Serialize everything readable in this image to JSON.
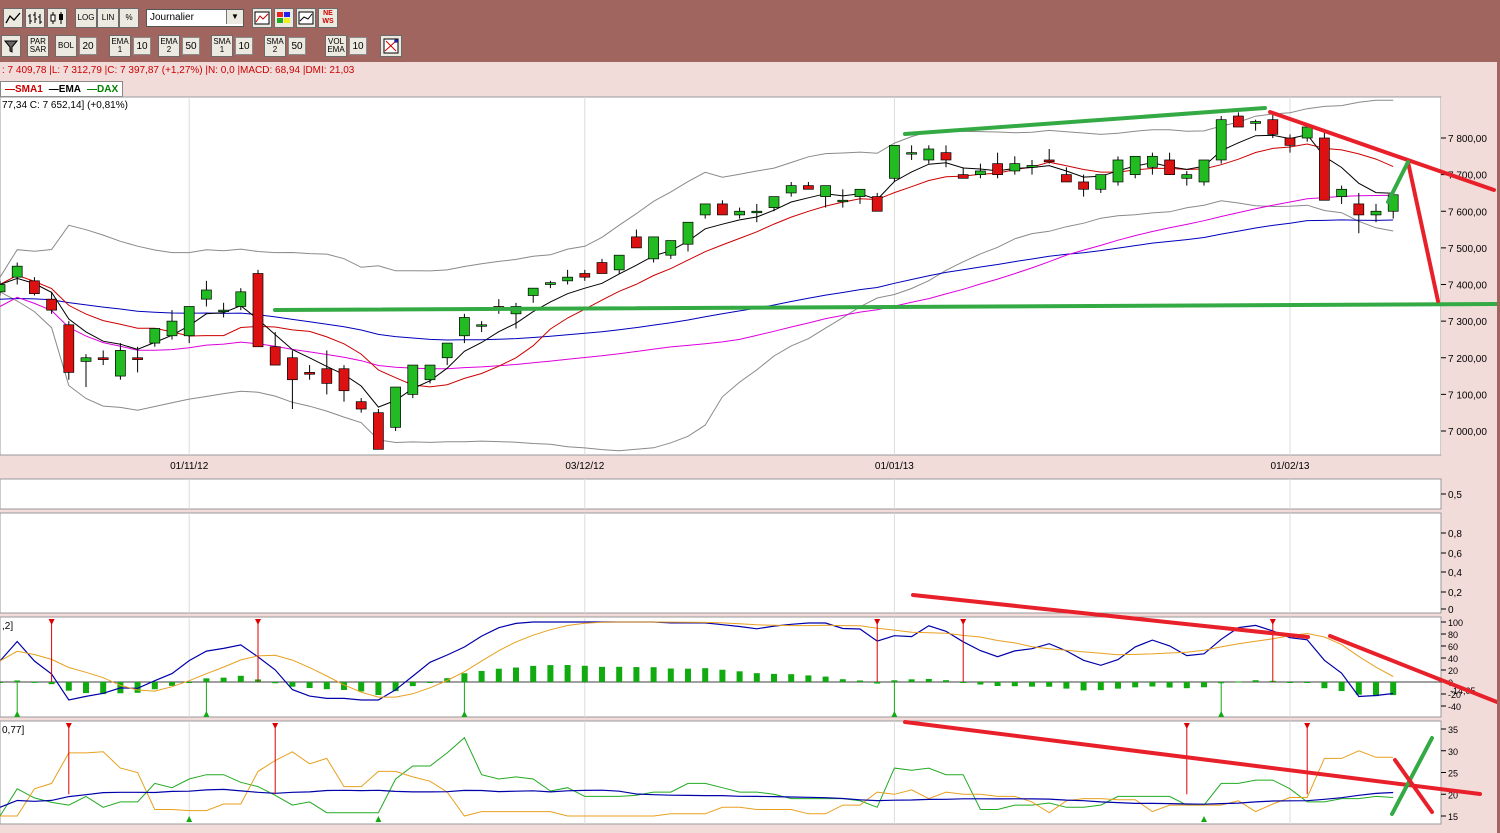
{
  "toolbar1": {
    "chart_style_buttons": [
      "line-chart-icon",
      "bar-chart-icon",
      "candlestick-icon"
    ],
    "scale_buttons": [
      "LOG",
      "LIN",
      "%"
    ],
    "period_value": "Journalier",
    "tool_buttons": [
      "zoom-icon",
      "color-icon",
      "compare-icon",
      "news-icon"
    ],
    "news_label": "NE\nWS"
  },
  "toolbar2": {
    "items": [
      {
        "label": "PAR\nSAR",
        "value": ""
      },
      {
        "label": "BOL",
        "value": "20"
      },
      {
        "label": "EMA\n1",
        "value": "10"
      },
      {
        "label": "EMA\n2",
        "value": "50"
      },
      {
        "label": "SMA\n1",
        "value": "10"
      },
      {
        "label": "SMA\n2",
        "value": "50"
      },
      {
        "label": "VOL\nEMA",
        "value": "10"
      }
    ]
  },
  "ohlc_line": ": 7 409,78 |L: 7 312,79 |C: 7 397,87 (+1,27%) |N: 0,0 |MACD: 68,94 |DMI: 21,03",
  "legend": [
    {
      "name": "SMA1",
      "color": "#cc0000"
    },
    {
      "name": "EMA",
      "color": "#000000"
    },
    {
      "name": "DAX",
      "color": "#008000"
    }
  ],
  "price_info": "77,34  C: 7 652,14] (+0,81%)",
  "macd_label": ",2]",
  "dmi_label": "0,77]",
  "colors": {
    "up_candle": "#22bb22",
    "down_candle": "#dd1111",
    "sma1": "#cc0000",
    "ema": "#000000",
    "blue_ma": "#0000bb",
    "magenta_ma": "#dd00dd",
    "bollinger": "#8a8a8a",
    "annotation_green": "#33aa44",
    "annotation_red": "#e8202a"
  },
  "chart_data": [
    {
      "type": "candlestick",
      "title": "DAX",
      "x_ticks": [
        "01/11/12",
        "03/12/12",
        "01/01/13",
        "01/02/13"
      ],
      "y_ticks": [
        "7 800,00",
        "7 700,00",
        "7 600,00",
        "7 500,00",
        "7 400,00",
        "7 300,00",
        "7 200,00",
        "7 100,00",
        "7 000,00"
      ],
      "ylim": [
        6950,
        7880
      ],
      "candles": [
        [
          7380,
          7410,
          7370,
          7400
        ],
        [
          7420,
          7460,
          7400,
          7450
        ],
        [
          7410,
          7420,
          7370,
          7375
        ],
        [
          7360,
          7380,
          7320,
          7330
        ],
        [
          7290,
          7300,
          7140,
          7160
        ],
        [
          7190,
          7210,
          7120,
          7200
        ],
        [
          7200,
          7220,
          7180,
          7195
        ],
        [
          7150,
          7240,
          7140,
          7220
        ],
        [
          7200,
          7230,
          7160,
          7195
        ],
        [
          7240,
          7280,
          7230,
          7280
        ],
        [
          7260,
          7330,
          7250,
          7300
        ],
        [
          7260,
          7330,
          7240,
          7340
        ],
        [
          7360,
          7410,
          7340,
          7385
        ],
        [
          7330,
          7350,
          7310,
          7330
        ],
        [
          7340,
          7390,
          7330,
          7380
        ],
        [
          7430,
          7440,
          7250,
          7230
        ],
        [
          7230,
          7270,
          7180,
          7180
        ],
        [
          7200,
          7220,
          7060,
          7140
        ],
        [
          7160,
          7180,
          7140,
          7155
        ],
        [
          7170,
          7220,
          7100,
          7130
        ],
        [
          7170,
          7180,
          7080,
          7110
        ],
        [
          7080,
          7090,
          7050,
          7060
        ],
        [
          7050,
          7060,
          6990,
          6950
        ],
        [
          7010,
          7020,
          7000,
          7120
        ],
        [
          7100,
          7120,
          7090,
          7180
        ],
        [
          7140,
          7150,
          7130,
          7180
        ],
        [
          7200,
          7240,
          7180,
          7240
        ],
        [
          7260,
          7320,
          7240,
          7310
        ],
        [
          7290,
          7300,
          7270,
          7290
        ],
        [
          7340,
          7360,
          7320,
          7330
        ],
        [
          7320,
          7350,
          7280,
          7340
        ],
        [
          7370,
          7380,
          7350,
          7390
        ],
        [
          7400,
          7410,
          7390,
          7405
        ],
        [
          7410,
          7440,
          7400,
          7420
        ],
        [
          7430,
          7440,
          7410,
          7420
        ],
        [
          7460,
          7470,
          7430,
          7430
        ],
        [
          7440,
          7460,
          7430,
          7480
        ],
        [
          7530,
          7550,
          7510,
          7500
        ],
        [
          7470,
          7500,
          7460,
          7530
        ],
        [
          7480,
          7510,
          7470,
          7520
        ],
        [
          7510,
          7560,
          7490,
          7570
        ],
        [
          7590,
          7600,
          7580,
          7620
        ],
        [
          7620,
          7630,
          7600,
          7590
        ],
        [
          7590,
          7610,
          7580,
          7600
        ],
        [
          7600,
          7620,
          7570,
          7600
        ],
        [
          7610,
          7630,
          7600,
          7640
        ],
        [
          7650,
          7680,
          7640,
          7670
        ],
        [
          7670,
          7680,
          7660,
          7660
        ],
        [
          7640,
          7670,
          7610,
          7670
        ],
        [
          7630,
          7660,
          7610,
          7630
        ],
        [
          7640,
          7660,
          7620,
          7660
        ],
        [
          7640,
          7650,
          7610,
          7600
        ],
        [
          7690,
          7780,
          7680,
          7780
        ],
        [
          7760,
          7780,
          7740,
          7760
        ],
        [
          7740,
          7780,
          7730,
          7770
        ],
        [
          7760,
          7780,
          7720,
          7740
        ],
        [
          7700,
          7720,
          7690,
          7690
        ],
        [
          7700,
          7730,
          7690,
          7710
        ],
        [
          7730,
          7760,
          7690,
          7700
        ],
        [
          7710,
          7750,
          7700,
          7730
        ],
        [
          7720,
          7740,
          7700,
          7725
        ],
        [
          7740,
          7770,
          7730,
          7735
        ],
        [
          7700,
          7720,
          7680,
          7680
        ],
        [
          7680,
          7700,
          7640,
          7660
        ],
        [
          7660,
          7690,
          7650,
          7700
        ],
        [
          7680,
          7750,
          7670,
          7740
        ],
        [
          7700,
          7740,
          7690,
          7750
        ],
        [
          7720,
          7760,
          7700,
          7750
        ],
        [
          7740,
          7760,
          7700,
          7700
        ],
        [
          7690,
          7710,
          7670,
          7700
        ],
        [
          7680,
          7730,
          7670,
          7740
        ],
        [
          7740,
          7860,
          7730,
          7850
        ],
        [
          7860,
          7870,
          7840,
          7830
        ],
        [
          7840,
          7850,
          7820,
          7845
        ],
        [
          7850,
          7870,
          7800,
          7810
        ],
        [
          7800,
          7810,
          7760,
          7780
        ],
        [
          7800,
          7830,
          7790,
          7830
        ],
        [
          7800,
          7820,
          7630,
          7630
        ],
        [
          7640,
          7670,
          7620,
          7660
        ],
        [
          7620,
          7650,
          7540,
          7590
        ],
        [
          7590,
          7620,
          7570,
          7600
        ],
        [
          7600,
          7660,
          7580,
          7645
        ]
      ]
    },
    {
      "type": "bar",
      "title": "MACD",
      "y_ticks": [
        "100",
        "80",
        "60",
        "40",
        "20",
        "0",
        "-20",
        "-40"
      ],
      "current_value": "-14,05"
    },
    {
      "type": "line",
      "title": "DMI",
      "y_ticks": [
        "35",
        "30",
        "25",
        "20",
        "15"
      ]
    }
  ],
  "empty_panel_ticks": {
    "panel1": [
      "0,5"
    ],
    "panel2": [
      "0,8",
      "0,6",
      "0,4",
      "0,2",
      "0"
    ]
  }
}
